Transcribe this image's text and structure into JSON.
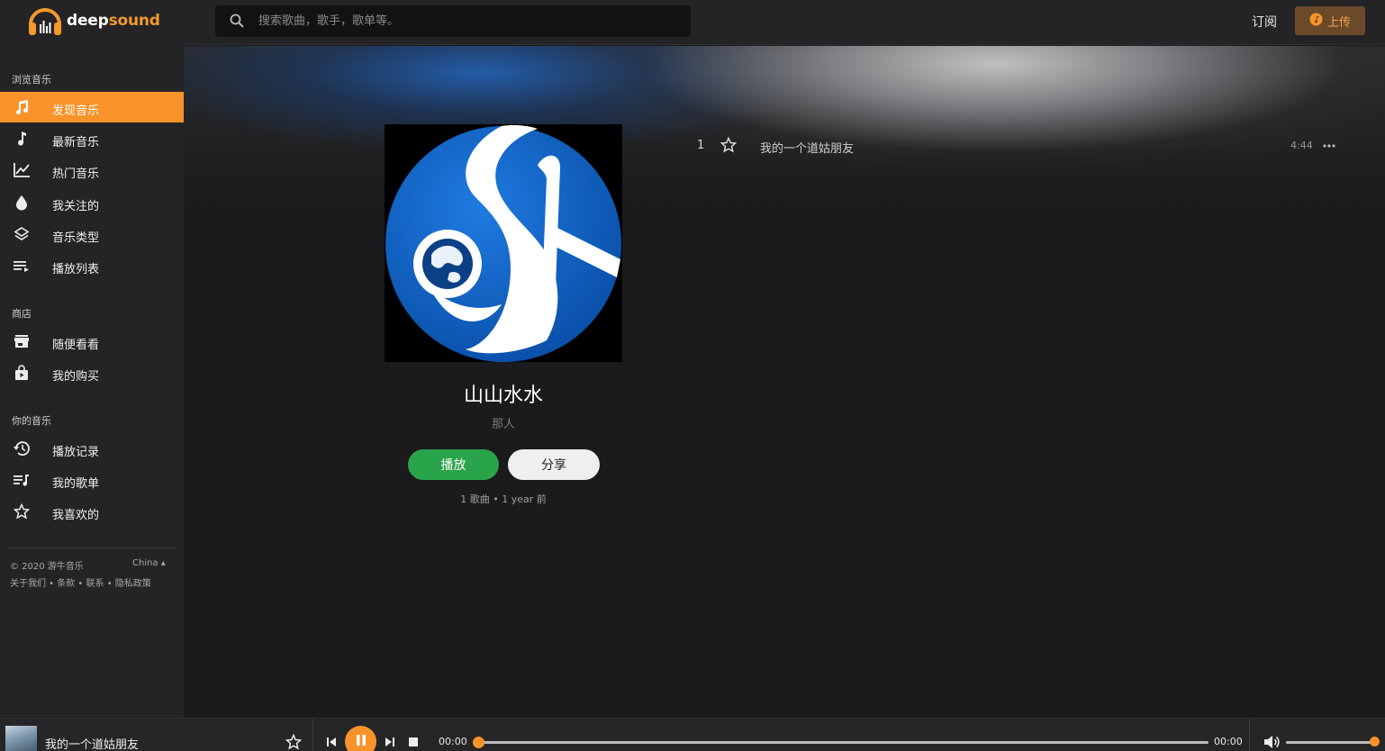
{
  "brand": {
    "name_part1": "deep",
    "name_part2": "sound"
  },
  "search": {
    "placeholder": "搜索歌曲，歌手，歌单等。"
  },
  "header": {
    "subscribe_label": "订阅",
    "upload_label": "上传"
  },
  "sidebar": {
    "sections": [
      {
        "title": "浏览音乐"
      },
      {
        "title": "商店"
      },
      {
        "title": "你的音乐"
      }
    ],
    "items": [
      {
        "label": "发现音乐",
        "icon": "music-notes-icon",
        "active": true
      },
      {
        "label": "最新音乐",
        "icon": "music-note-icon"
      },
      {
        "label": "热门音乐",
        "icon": "trending-icon"
      },
      {
        "label": "我关注的",
        "icon": "drop-icon"
      },
      {
        "label": "音乐类型",
        "icon": "layers-icon"
      },
      {
        "label": "播放列表",
        "icon": "playlist-icon"
      },
      {
        "label": "随便看看",
        "icon": "store-icon"
      },
      {
        "label": "我的购买",
        "icon": "shopping-bag-icon"
      },
      {
        "label": "播放记录",
        "icon": "history-icon"
      },
      {
        "label": "我的歌单",
        "icon": "my-playlist-icon"
      },
      {
        "label": "我喜欢的",
        "icon": "star-icon"
      }
    ],
    "footer": {
      "copyright": "© 2020 游牛音乐",
      "language": "China ▴",
      "links": "关于我们 • 条款 • 联系 • 隐私政策"
    }
  },
  "album": {
    "title": "山山水水",
    "artist": "那人",
    "play_label": "播放",
    "share_label": "分享",
    "meta": "1 歌曲 • 1 year 前"
  },
  "tracks": [
    {
      "number": "1",
      "title": "我的一个道姑朋友",
      "duration": "4:44"
    }
  ],
  "player": {
    "now_playing": "我的一个道姑朋友",
    "current_time": "00:00",
    "total_time": "00:00",
    "progress": 0,
    "volume": 1.0
  },
  "colors": {
    "accent": "#f7932a",
    "play_green": "#2aa44a",
    "background": "#1b1b1d",
    "sidebar": "#242426"
  }
}
